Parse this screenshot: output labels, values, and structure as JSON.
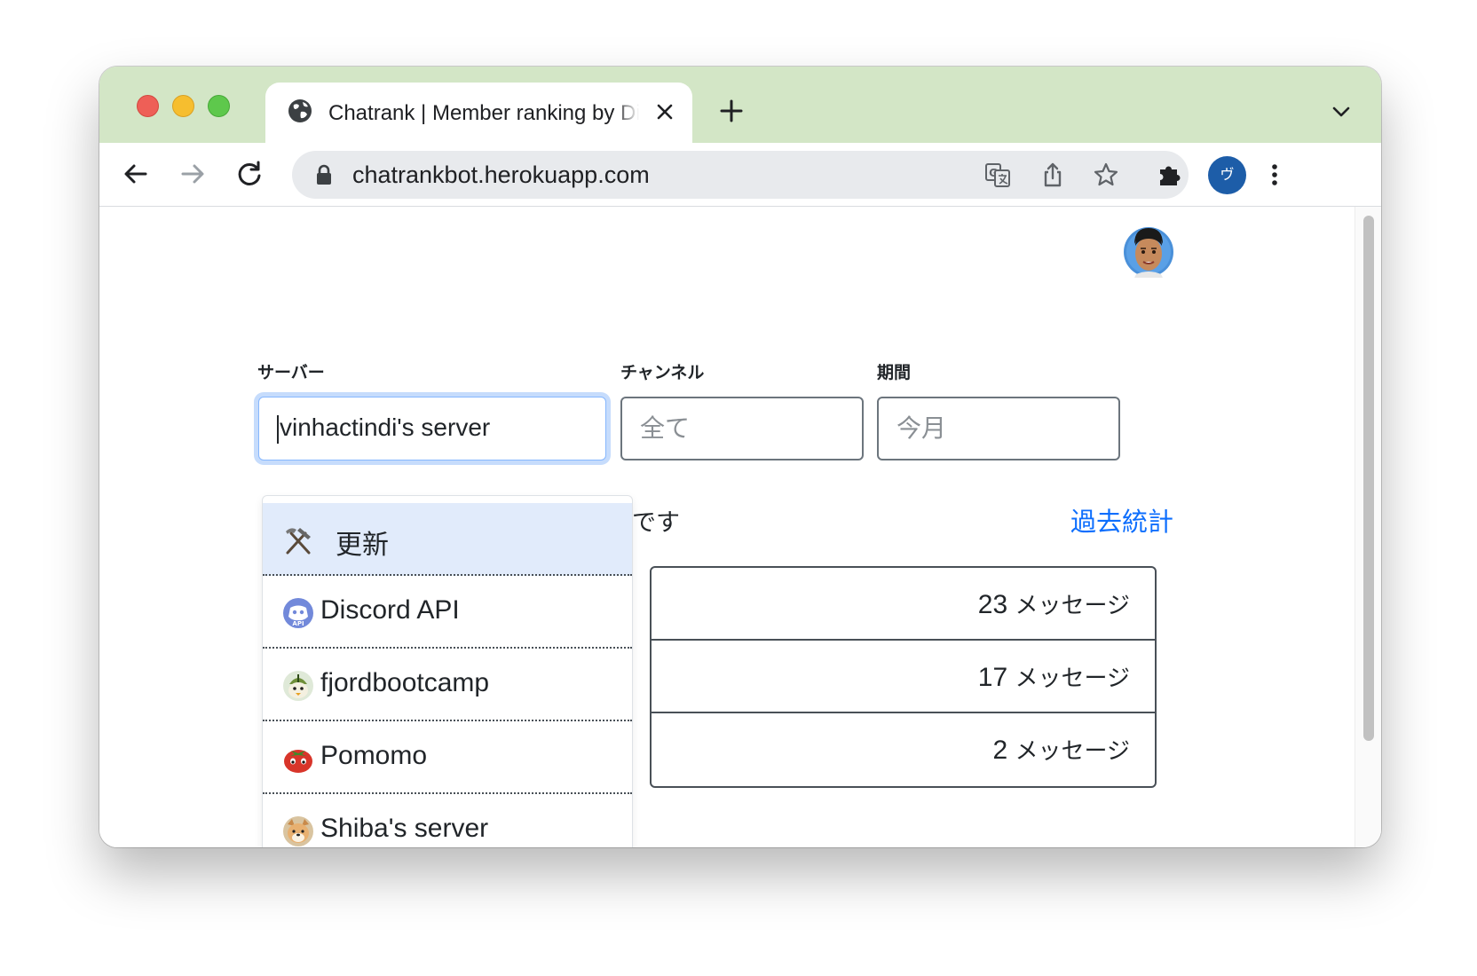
{
  "browser": {
    "tab_title": "Chatrank | Member ranking by Discord",
    "url": "chatrankbot.herokuapp.com",
    "profile_initial": "ヴ"
  },
  "form": {
    "server_label": "サーバー",
    "server_value": "vinhactindi's server",
    "channel_label": "チャンネル",
    "channel_placeholder": "全て",
    "period_label": "期間",
    "period_placeholder": "今月"
  },
  "summary_suffix": "です",
  "past_stats_link": "過去統計",
  "ranking": [
    {
      "count": "23",
      "unit": "メッセージ"
    },
    {
      "count": "17",
      "unit": "メッセージ"
    },
    {
      "count": "2",
      "unit": "メッセージ"
    }
  ],
  "dropdown": {
    "items": [
      {
        "label": "更新",
        "icon": "hammer-pick-icon"
      },
      {
        "label": "Discord API",
        "icon": "discord-api-icon"
      },
      {
        "label": "fjordbootcamp",
        "icon": "fjord-icon"
      },
      {
        "label": "Pomomo",
        "icon": "tomato-icon"
      },
      {
        "label": "Shiba's server",
        "icon": "shiba-icon"
      }
    ]
  }
}
